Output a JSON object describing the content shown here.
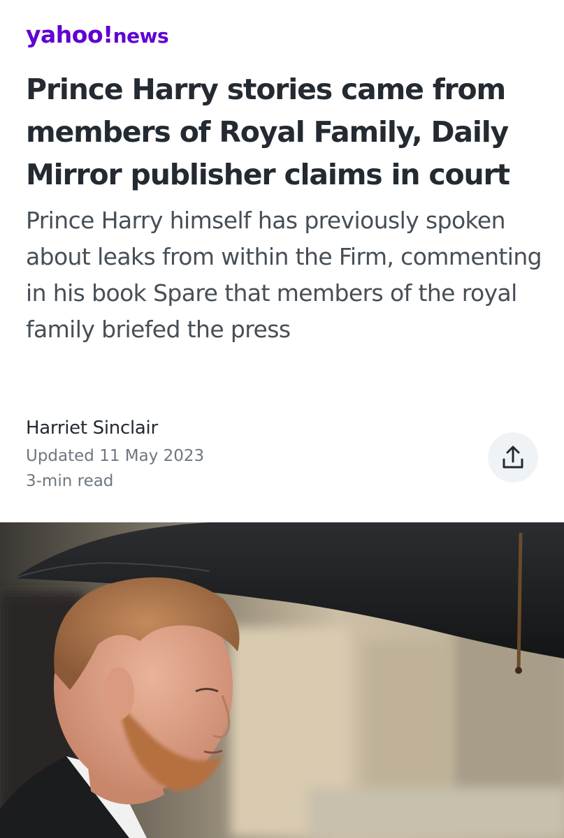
{
  "header": {
    "logo_brand": "yahoo!",
    "logo_section": "news"
  },
  "article": {
    "headline": "Prince Harry stories came from members of Royal Family, Daily Mirror publisher claims in court",
    "subheadline": "Prince Harry himself has previously spoken about leaks from within the Firm, commenting in his book Spare that members of the royal family briefed the press",
    "author": "Harriet Sinclair",
    "updated": "Updated 11 May 2023",
    "read_time": "3-min read"
  },
  "colors": {
    "brand": "#6001d2",
    "headline": "#232a31",
    "body": "#464e56",
    "meta": "#6e7780",
    "share_bg": "#f0f3f5"
  },
  "icons": {
    "share": "share-upload-icon"
  }
}
